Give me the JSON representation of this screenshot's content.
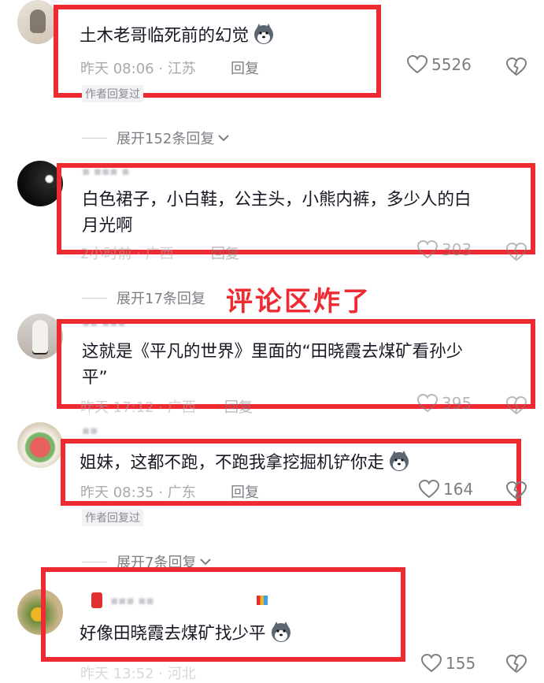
{
  "comments": [
    {
      "text": "土木老哥临死前的幻觉",
      "meta": "昨天 08:06 · 江苏",
      "reply_label": "回复",
      "likes": "5526",
      "tag": "作者回复过",
      "expand_label": "展开152条回复"
    },
    {
      "text_line1": "白色裙子，小白鞋，公主头，小熊内裤，多少人的白",
      "text_line2": "月光啊",
      "meta": "2小时前 · 广西",
      "reply_label": "回复",
      "likes": "303",
      "expand_label": "展开17条回复"
    },
    {
      "text_line1": "这就是《平凡的世界》里面的“田晓霞去煤矿看孙少",
      "text_line2": "平”",
      "meta": "昨天 17:12 · 广西",
      "reply_label": "回复",
      "likes": "395"
    },
    {
      "text": "姐妹，这都不跑，不跑我拿挖掘机铲你走",
      "meta": "昨天 08:35 · 广东",
      "reply_label": "回复",
      "likes": "164",
      "tag": "作者回复过",
      "expand_label": "展开7条回复"
    },
    {
      "text": "好像田晓霞去煤矿找少平",
      "meta": "昨天 13:52 · 河北",
      "likes": "155"
    }
  ],
  "overlay_caption": "评论区炸了",
  "accent_color": "#ee2a33",
  "icons": [
    "heart-icon",
    "broken-heart-icon",
    "chevron-down-icon",
    "husky-emoji-icon"
  ]
}
